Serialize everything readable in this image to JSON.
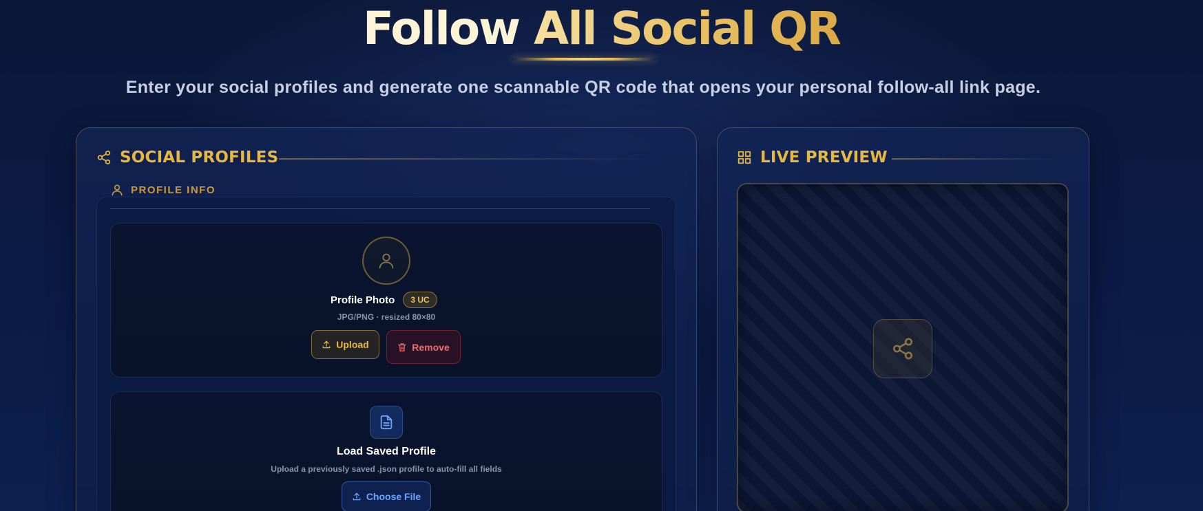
{
  "header": {
    "title_part1": "Follow",
    "title_part2": "All Social QR",
    "subtitle": "Enter your social profiles and generate one scannable QR code that opens your personal follow-all link page."
  },
  "left_panel": {
    "title": "SOCIAL PROFILES",
    "icon": "share-icon",
    "section": {
      "title": "PROFILE INFO",
      "icon": "user-icon"
    },
    "profile_photo": {
      "title": "Profile Photo",
      "badge": "3 UC",
      "hint": "JPG/PNG · resized 80×80",
      "upload_label": "Upload",
      "remove_label": "Remove"
    },
    "load_profile": {
      "title": "Load Saved Profile",
      "hint": "Upload a previously saved .json profile to auto-fill all fields",
      "choose_label": "Choose File",
      "icon": "document-icon"
    }
  },
  "right_panel": {
    "title": "LIVE PREVIEW",
    "icon": "grid-icon",
    "placeholder_icon": "share-icon"
  },
  "colors": {
    "accent_gold": "#e7b741",
    "accent_blue": "#6aa6ff",
    "danger_red": "#f06a6a",
    "background": "#0c1838"
  }
}
